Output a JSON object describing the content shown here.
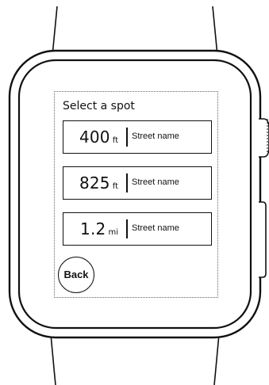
{
  "screen": {
    "title": "Select a spot"
  },
  "spots": [
    {
      "value": "400",
      "unit": "ft",
      "street": "Street name"
    },
    {
      "value": "825",
      "unit": "ft",
      "street": "Street name"
    },
    {
      "value": "1.2",
      "unit": "mi",
      "street": "Street name"
    }
  ],
  "back_button": {
    "label": "Back"
  }
}
